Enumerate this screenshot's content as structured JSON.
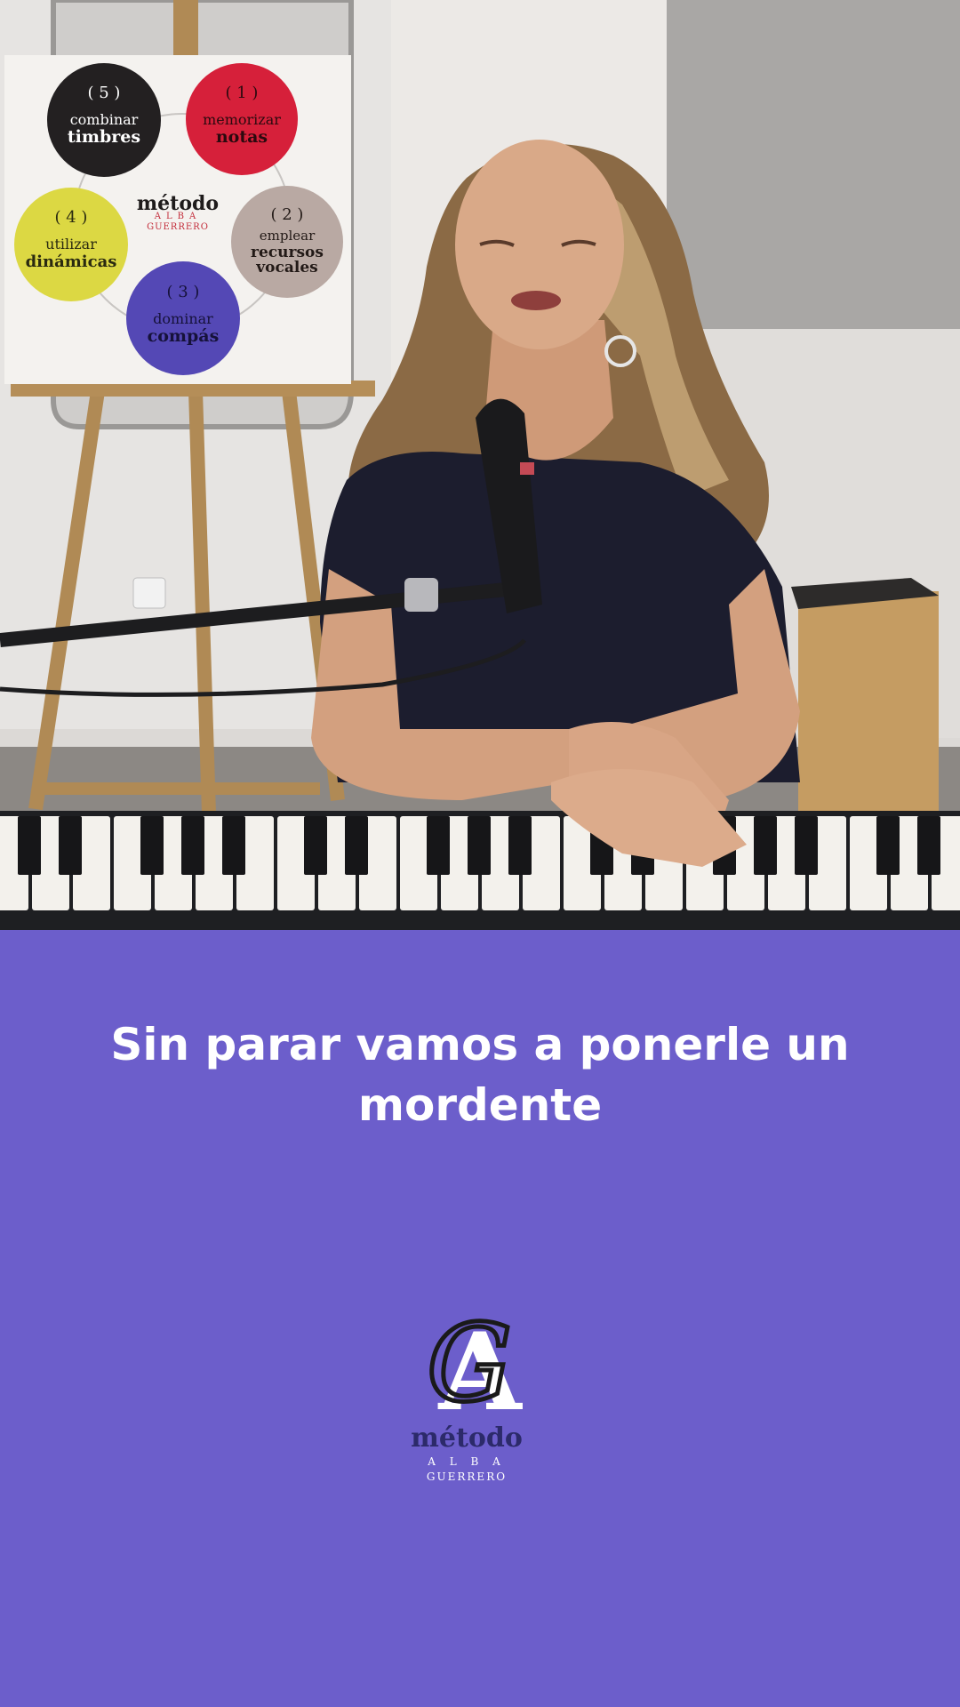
{
  "video": {
    "poster": {
      "center_title": "método",
      "center_sub1": "ALBA",
      "center_sub2": "GUERRERO",
      "circles": [
        {
          "num": "( 1 )",
          "line1": "memorizar",
          "line2": "notas",
          "line3": "",
          "color": "#d6203a"
        },
        {
          "num": "( 2 )",
          "line1": "emplear",
          "line2": "recursos",
          "line3": "vocales",
          "color": "#b9a9a3"
        },
        {
          "num": "( 3 )",
          "line1": "dominar",
          "line2": "compás",
          "line3": "",
          "color": "#5448b5"
        },
        {
          "num": "( 4 )",
          "line1": "utilizar",
          "line2": "dinámicas",
          "line3": "",
          "color": "#dcd843"
        },
        {
          "num": "( 5 )",
          "line1": "combinar",
          "line2": "timbres",
          "line3": "",
          "color": "#232021"
        }
      ]
    }
  },
  "caption": {
    "line1": "Sin parar vamos a ponerle un",
    "line2": "mordente"
  },
  "logo": {
    "word": "método",
    "sub1": "A L B A",
    "sub2": "GUERRERO"
  },
  "colors": {
    "background": "#6c5ecb",
    "caption_text": "#ffffff"
  }
}
